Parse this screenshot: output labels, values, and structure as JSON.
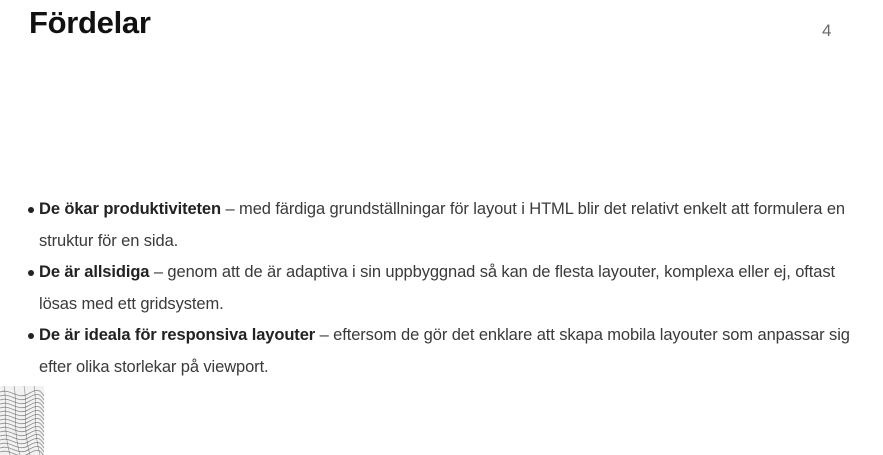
{
  "slide": {
    "title": "Fördelar",
    "page_number": "4"
  },
  "bullets": [
    {
      "lead": "De ökar produktiviteten",
      "text": " – med färdiga grundställningar för layout i HTML blir det relativt enkelt att formulera en struktur för en sida."
    },
    {
      "lead": "De är allsidiga",
      "text": " – genom att de är adaptiva i sin uppbyggnad så kan de flesta layouter, komplexa eller ej, oftast lösas med ett gridsystem."
    },
    {
      "lead": "De är ideala för responsiva layouter",
      "text": " – eftersom de gör det enklare att skapa mobila layouter som anpassar sig efter olika storlekar på viewport."
    }
  ]
}
